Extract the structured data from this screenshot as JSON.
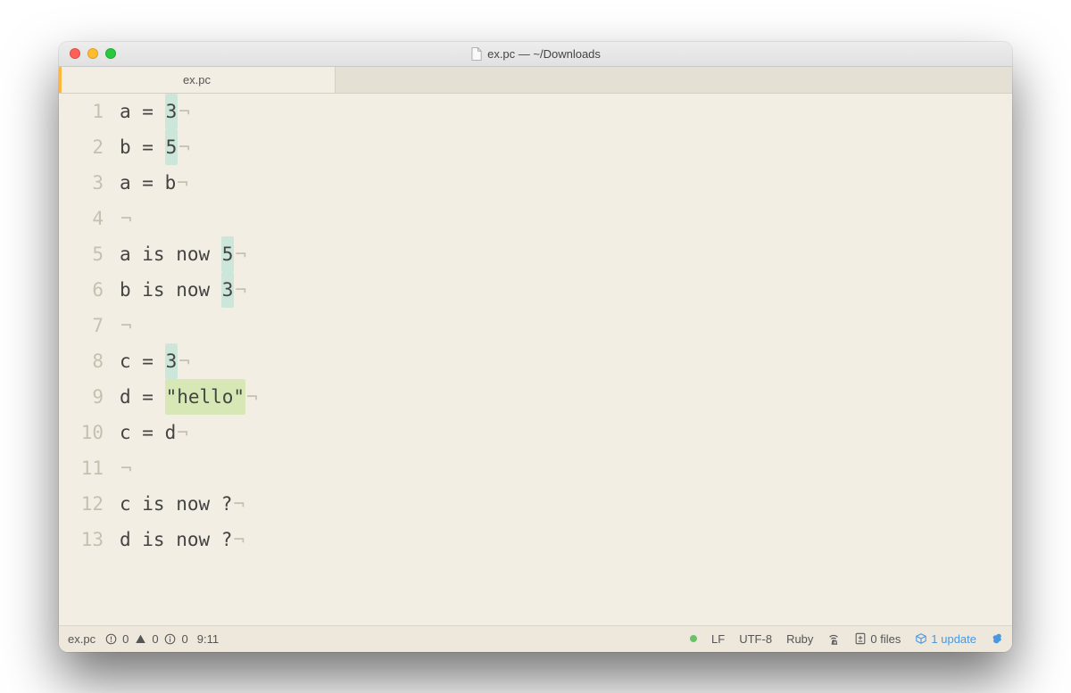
{
  "window": {
    "title": "ex.pc — ~/Downloads"
  },
  "tab": {
    "active_label": "ex.pc"
  },
  "editor": {
    "eol_marker": "¬",
    "lines": [
      {
        "num": "1",
        "segments": [
          {
            "t": "a = ",
            "c": "plain"
          },
          {
            "t": "3",
            "c": "num"
          }
        ]
      },
      {
        "num": "2",
        "segments": [
          {
            "t": "b = ",
            "c": "plain"
          },
          {
            "t": "5",
            "c": "num"
          }
        ]
      },
      {
        "num": "3",
        "segments": [
          {
            "t": "a = b",
            "c": "plain"
          }
        ]
      },
      {
        "num": "4",
        "segments": []
      },
      {
        "num": "5",
        "segments": [
          {
            "t": "a is now ",
            "c": "plain"
          },
          {
            "t": "5",
            "c": "num"
          }
        ]
      },
      {
        "num": "6",
        "segments": [
          {
            "t": "b is now ",
            "c": "plain"
          },
          {
            "t": "3",
            "c": "num"
          }
        ]
      },
      {
        "num": "7",
        "segments": []
      },
      {
        "num": "8",
        "segments": [
          {
            "t": "c = ",
            "c": "plain"
          },
          {
            "t": "3",
            "c": "num"
          }
        ]
      },
      {
        "num": "9",
        "segments": [
          {
            "t": "d = ",
            "c": "plain"
          },
          {
            "t": "\"hello\"",
            "c": "str"
          }
        ]
      },
      {
        "num": "10",
        "segments": [
          {
            "t": "c = d",
            "c": "plain"
          }
        ]
      },
      {
        "num": "11",
        "segments": []
      },
      {
        "num": "12",
        "segments": [
          {
            "t": "c is now ?",
            "c": "plain"
          }
        ]
      },
      {
        "num": "13",
        "segments": [
          {
            "t": "d is now ?",
            "c": "plain"
          }
        ]
      }
    ]
  },
  "status": {
    "filename": "ex.pc",
    "diag_error_count": "0",
    "diag_warn_count": "0",
    "diag_info_count": "0",
    "cursor": "9:11",
    "line_ending": "LF",
    "encoding": "UTF-8",
    "syntax": "Ruby",
    "git_files": "0 files",
    "updates": "1 update"
  }
}
